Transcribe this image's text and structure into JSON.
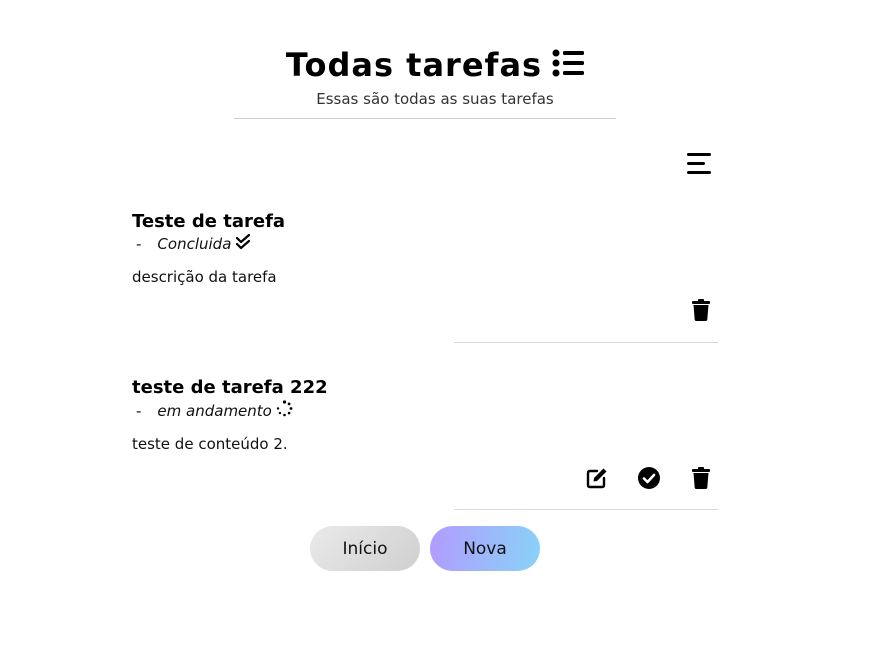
{
  "header": {
    "title": "Todas tarefas",
    "subtitle": "Essas são todas as suas tarefas",
    "title_icon": "list-icon"
  },
  "toolbar": {
    "menu_icon": "menu-icon"
  },
  "tasks": [
    {
      "title": "Teste de tarefa",
      "dash": "-",
      "status": "Concluida",
      "status_icon": "double-check-icon",
      "description": "descrição da tarefa",
      "actions": [
        "trash-icon"
      ]
    },
    {
      "title": "teste de tarefa 222",
      "dash": "-",
      "status": "em andamento",
      "status_icon": "spinner-icon",
      "description": "teste de conteúdo 2.",
      "actions": [
        "edit-icon",
        "check-circle-icon",
        "trash-icon"
      ]
    }
  ],
  "buttons": {
    "home_label": "Início",
    "new_label": "Nova"
  },
  "colors": {
    "new_gradient_start": "#b29bff",
    "new_gradient_end": "#88d3f7",
    "home_bg": "#dcdcdc"
  }
}
